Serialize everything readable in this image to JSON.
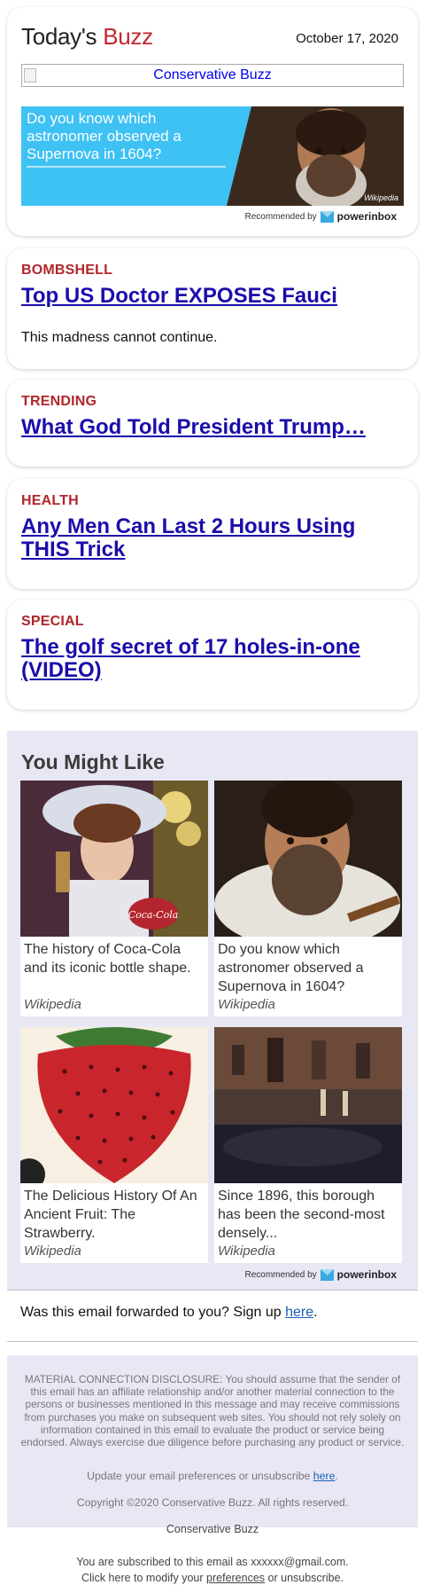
{
  "header": {
    "brand_part1": "Today's",
    "brand_part2": "Buzz",
    "date": "October 17, 2020",
    "banner_alt": "Conservative Buzz",
    "ad": {
      "text": "Do you know which astronomer observed a Supernova in 1604?",
      "credit": "Wikipedia",
      "background_color": "#3ec1f3"
    },
    "recommended_by": "Recommended by",
    "recommender": "powerinbox"
  },
  "stories": [
    {
      "kicker": "BOMBSHELL",
      "headline": "Top US Doctor EXPOSES Fauci",
      "sub": "This madness cannot continue."
    },
    {
      "kicker": "TRENDING",
      "headline": "What God Told President Trump…",
      "sub": ""
    },
    {
      "kicker": "HEALTH",
      "headline": "Any Men Can Last 2 Hours Using THIS Trick",
      "sub": ""
    },
    {
      "kicker": "SPECIAL",
      "headline": "The golf secret of 17 holes-in-one (VIDEO)",
      "sub": ""
    }
  ],
  "you_might_like": {
    "title": "You Might Like",
    "items": [
      {
        "title": "The history of Coca-Cola and its iconic bottle shape.",
        "source": "Wikipedia",
        "image_icon": "coca-cola-girl-image"
      },
      {
        "title": "Do you know which astronomer observed a Supernova in 1604?",
        "source": "Wikipedia",
        "image_icon": "astronomer-portrait-image"
      },
      {
        "title": "The Delicious History Of An Ancient Fruit: The Strawberry.",
        "source": "Wikipedia",
        "image_icon": "strawberry-image"
      },
      {
        "title": "Since 1896, this borough has been the second-most densely...",
        "source": "Wikipedia",
        "image_icon": "street-night-image"
      }
    ],
    "recommended_by": "Recommended by",
    "recommender": "powerinbox"
  },
  "forward": {
    "text": "Was this email forwarded to you? Sign up",
    "link": "here",
    "suffix": "."
  },
  "footer": {
    "disclosure": "MATERIAL CONNECTION DISCLOSURE: You should assume that the sender of this email has an affiliate relationship and/or another material connection to the persons or businesses mentioned in this message and may receive commissions from purchases you make on subsequent web sites. You should not rely solely on information contained in this email to evaluate the product or service being endorsed. Always exercise due diligence before purchasing any product or service.",
    "prefs_text": "Update your email preferences or unsubscribe",
    "prefs_link": "here",
    "prefs_suffix": ".",
    "copyright": "Copyright ©2020 Conservative Buzz. All rights reserved.",
    "sender": "Conservative Buzz",
    "subscribed_line": "You are subscribed to this email as xxxxxx@gmail.com.",
    "modify_prefix": "Click here to modify your",
    "modify_link": "preferences",
    "modify_suffix": "or unsubscribe."
  },
  "colors": {
    "brand_red": "#c0282d",
    "kicker_red": "#b0262b",
    "link_blue": "#1a0dab",
    "section_bg": "#e7e8f4"
  }
}
